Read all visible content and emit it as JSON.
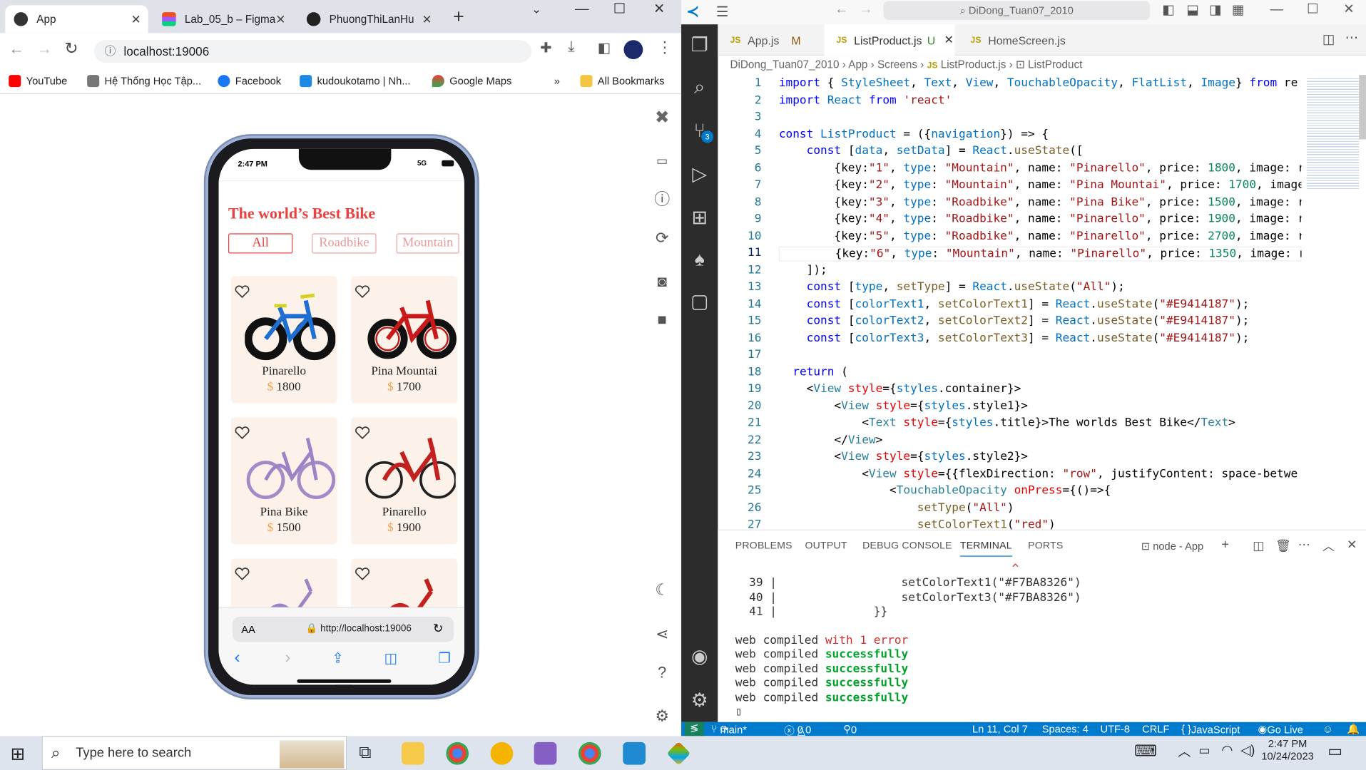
{
  "chrome": {
    "tabs": [
      {
        "title": "App",
        "favicon": "expo-icon"
      },
      {
        "title": "Lab_05_b – Figma",
        "favicon": "figma-icon"
      },
      {
        "title": "PhuongThiLanHu",
        "favicon": "github-icon"
      }
    ],
    "new_tab": "+",
    "url": "localhost:19006",
    "bookmarks": [
      "YouTube",
      "Hệ Thống Học Tập...",
      "Facebook",
      "kudoukotamo | Nh...",
      "Google Maps",
      "All Bookmarks"
    ],
    "bookmarks_overflow": "»"
  },
  "phone": {
    "time": "2:47 PM",
    "signal": "5G",
    "title": "The world’s Best Bike",
    "filters": [
      "All",
      "Roadbike",
      "Mountain"
    ],
    "currency": "$",
    "products": [
      {
        "name": "Pinarello",
        "price": "1800"
      },
      {
        "name": "Pina Mountai",
        "price": "1700"
      },
      {
        "name": "Pina Bike",
        "price": "1500"
      },
      {
        "name": "Pinarello",
        "price": "1900"
      },
      {
        "name": "",
        "price": ""
      },
      {
        "name": "",
        "price": ""
      }
    ],
    "safari": {
      "aa": "AA",
      "url": "http://localhost:19006"
    }
  },
  "vscode": {
    "title": "DiDong_Tuan07_2010",
    "tabs": [
      {
        "name": "App.js",
        "badge": "M"
      },
      {
        "name": "ListProduct.js",
        "badge": "U"
      },
      {
        "name": "HomeScreen.js",
        "badge": ""
      }
    ],
    "breadcrumbs": [
      "DiDong_Tuan07_2010",
      "App",
      "Screens",
      "ListProduct.js",
      "ListProduct"
    ],
    "scm_badge": "3",
    "code_lines": [
      "import { StyleSheet, Text, View, TouchableOpacity, FlatList, Image} from 're",
      "import React from 'react'",
      "",
      "const ListProduct = ({navigation}) => {",
      "    const [data, setData] = React.useState([",
      "        {key:\"1\", type: \"Mountain\", name: \"Pinarello\", price: 1800, image: r",
      "        {key:\"2\", type: \"Mountain\", name: \"Pina Mountai\", price: 1700, image",
      "        {key:\"3\", type: \"Roadbike\", name: \"Pina Bike\", price: 1500, image: r",
      "        {key:\"4\", type: \"Roadbike\", name: \"Pinarello\", price: 1900, image: r",
      "        {key:\"5\", type: \"Roadbike\", name: \"Pinarello\", price: 2700, image: r",
      "        {key:\"6\", type: \"Mountain\", name: \"Pinarello\", price: 1350, image: r",
      "    ]);",
      "    const [type, setType] = React.useState(\"All\");",
      "    const [colorText1, setColorText1] = React.useState(\"#E9414187\");",
      "    const [colorText2, setColorText2] = React.useState(\"#E9414187\");",
      "    const [colorText3, setColorText3] = React.useState(\"#E9414187\");",
      "",
      "  return (",
      "    <View style={styles.container}>",
      "        <View style={styles.style1}>",
      "            <Text style={styles.title}>The world's Best Bike</Text>",
      "        </View>",
      "        <View style={styles.style2}>",
      "            <View style={{flexDirection: \"row\", justifyContent: 'space-betwe",
      "                <TouchableOpacity onPress={()=>{",
      "                    setType(\"All\")",
      "                    setColorText1(\"red\")"
    ],
    "panel_tabs": [
      "PROBLEMS",
      "OUTPUT",
      "DEBUG CONSOLE",
      "TERMINAL",
      "PORTS"
    ],
    "terminal_name": "node - App",
    "terminal": {
      "caret": "^",
      "lines": [
        {
          "n": "39",
          "text": "setColorText1(\"#F7BA8326\")"
        },
        {
          "n": "40",
          "text": "setColorText3(\"#F7BA8326\")"
        },
        {
          "n": "41",
          "text": "}}"
        }
      ],
      "compile_prefix": "web compiled",
      "compile_error": "with 1 error",
      "compile_success": "successfully"
    },
    "status": {
      "branch": "main*",
      "errors": "0",
      "warnings": "0",
      "ports": "0",
      "position": "Ln 11, Col 7",
      "spaces": "Spaces: 4",
      "encoding": "UTF-8",
      "eol": "CRLF",
      "language": "JavaScript",
      "golive": "Go Live"
    }
  },
  "taskbar": {
    "search_placeholder": "Type here to search",
    "time": "2:47 PM",
    "date": "10/24/2023"
  }
}
